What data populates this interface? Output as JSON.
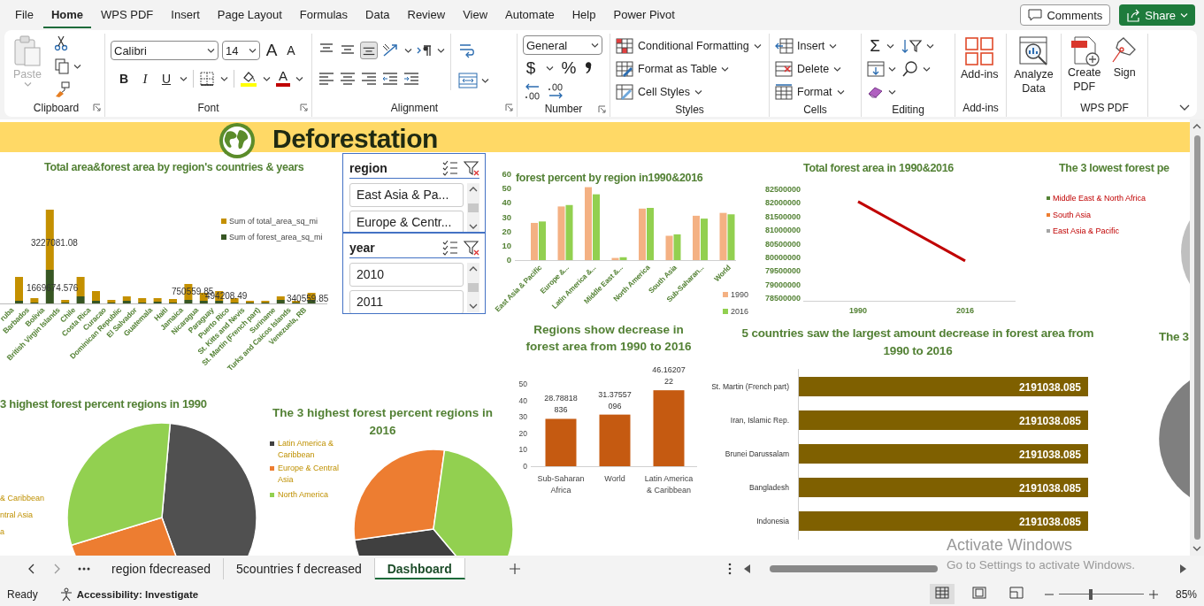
{
  "menu_tabs": [
    {
      "label": "File",
      "selected": false
    },
    {
      "label": "Home",
      "selected": true
    },
    {
      "label": "WPS PDF",
      "selected": false
    },
    {
      "label": "Insert",
      "selected": false
    },
    {
      "label": "Page Layout",
      "selected": false
    },
    {
      "label": "Formulas",
      "selected": false
    },
    {
      "label": "Data",
      "selected": false
    },
    {
      "label": "Review",
      "selected": false
    },
    {
      "label": "View",
      "selected": false
    },
    {
      "label": "Automate",
      "selected": false
    },
    {
      "label": "Help",
      "selected": false
    },
    {
      "label": "Power Pivot",
      "selected": false
    }
  ],
  "comments_button": "Comments",
  "share_button": "Share",
  "ribbon": {
    "clipboard": {
      "paste": "Paste",
      "paste_disabled": true,
      "label": "Clipboard"
    },
    "font": {
      "name": "Calibri",
      "size": "14",
      "grow": "A",
      "shrink": "A",
      "bold": "B",
      "italic": "I",
      "underline": "U",
      "font_color": "A",
      "label": "Font"
    },
    "alignment": {
      "vertical": [
        {
          "selected": false
        },
        {
          "selected": false
        },
        {
          "selected": true
        }
      ],
      "label": "Alignment"
    },
    "number": {
      "format": "General",
      "currency": "$",
      "percent": "%",
      "label": "Number"
    },
    "styles": {
      "items": [
        "Conditional Formatting",
        "Format as Table",
        "Cell Styles"
      ],
      "label": "Styles"
    },
    "cells": {
      "items": [
        "Insert",
        "Delete",
        "Format"
      ],
      "label": "Cells"
    },
    "editing": {
      "autosum": "Σ",
      "label": "Editing"
    },
    "addins": {
      "button": "Add-ins",
      "label": "Add-ins"
    },
    "analyze": {
      "button": "Analyze Data"
    },
    "wps_pdf": {
      "buttons": [
        "Create PDF",
        "Sign"
      ],
      "label": "WPS PDF"
    }
  },
  "dashboard": {
    "title": "Deforestation",
    "area_chart": {
      "title": "Total area&forest area by region's countries & years",
      "legend": [
        {
          "name": "Sum of total_area_sq_mi",
          "color": "#c49000"
        },
        {
          "name": "Sum of forest_area_sq_mi",
          "color": "#375623"
        }
      ],
      "categories": [
        "ruba",
        "Barbados",
        "Bolivia",
        "British Virgin Islands",
        "Chile",
        "Costa Rica",
        "Curacao",
        "Dominican Republic",
        "El Salvador",
        "Guatemala",
        "Haiti",
        "Jamaica",
        "Nicaragua",
        "Paraguay",
        "Puerto Rico",
        "St. Kitts and Nevis",
        "St. Martin (French part)",
        "Suriname",
        "Turks and Caicos Islands",
        "Venezuela, RB"
      ],
      "value_labels": [
        "3227081.08",
        "1669674.576",
        "750559.85",
        "494208.49",
        "340559.85"
      ]
    },
    "region_slicer": {
      "title": "region",
      "items": [
        "East Asia & Pa...",
        "Europe & Centr..."
      ]
    },
    "year_slicer": {
      "title": "year",
      "items": [
        "2010",
        "2011"
      ]
    },
    "percent_chart": {
      "chart_data": {
        "type": "bar",
        "title": "forest percent by region in1990&2016",
        "categories": [
          "East Asia & Pacific",
          "Europe &...",
          "Latin America &...",
          "Middle East &...",
          "North America",
          "South Asia",
          "Sub-Saharan...",
          "World"
        ],
        "series": [
          {
            "name": "1990",
            "color": "#f4b183",
            "values": [
              26,
              37.5,
              51,
              1.5,
              36,
              17,
              31,
              33
            ]
          },
          {
            "name": "2016",
            "color": "#92d050",
            "values": [
              27,
              38.5,
              46,
              2,
              36.5,
              18,
              29,
              32
            ]
          }
        ],
        "ylim": [
          0,
          60
        ],
        "yticks": [
          0,
          10,
          20,
          30,
          40,
          50,
          60
        ],
        "legend": true
      }
    },
    "total_chart": {
      "chart_data": {
        "type": "line",
        "title": "Total forest area in 1990&2016",
        "categories": [
          "1990",
          "2016"
        ],
        "series": [
          {
            "color": "#c00000",
            "values": [
              82050000,
              79870000
            ]
          }
        ],
        "ylim": [
          78500000,
          82500000
        ],
        "yticks": [
          78500000,
          79000000,
          79500000,
          80000000,
          80500000,
          81000000,
          81500000,
          82000000,
          82500000
        ]
      }
    },
    "lowest_pie": {
      "title": "The 3 lowest forest pe",
      "legend": [
        {
          "name": "Middle East & North Africa",
          "color": "#548235"
        },
        {
          "name": "South Asia",
          "color": "#ed7d31"
        },
        {
          "name": "East Asia & Pacific",
          "color": "#a5a5a5"
        }
      ]
    },
    "decrease_chart": {
      "chart_data": {
        "type": "bar",
        "title": "Regions show decrease in forest area from 1990 to 2016",
        "categories": [
          "Sub-Saharan Africa",
          "World",
          "Latin America & Caribbean"
        ],
        "series": [
          {
            "color": "#c55a11",
            "values": [
              28.78818836,
              31.37557096,
              46.1620722
            ]
          }
        ],
        "ylim": [
          0,
          50
        ],
        "yticks": [
          0,
          10,
          20,
          30,
          40,
          50
        ],
        "data_labels": true
      }
    },
    "countries_chart": {
      "chart_data": {
        "type": "bar",
        "orientation": "horizontal",
        "title": "5 countries saw the largest amount decrease in forest area from 1990 to 2016",
        "categories": [
          "St. Martin (French part)",
          "Iran, Islamic Rep.",
          "Brunei Darussalam",
          "Bangladesh",
          "Indonesia"
        ],
        "series": [
          {
            "color": "#7f6000",
            "values": [
              2191038.085,
              2191038.085,
              2191038.085,
              2191038.085,
              2191038.085
            ]
          }
        ],
        "data_labels": true
      }
    },
    "third_pie": {
      "title": "The 3"
    },
    "pie_1990": {
      "title": "3 highest forest percent regions in 1990",
      "legend": [
        "& Caribbean",
        "ntral Asia",
        "a"
      ]
    },
    "pie_2016": {
      "title": "The 3 highest forest percent regions in 2016",
      "legend": [
        {
          "name": "Latin America & Caribbean",
          "color": "#404040"
        },
        {
          "name": "Europe & Central Asia",
          "color": "#ed7d31"
        },
        {
          "name": "North America",
          "color": "#92d050"
        }
      ]
    }
  },
  "sheet_tabs": [
    {
      "label": "region fdecreased",
      "selected": false
    },
    {
      "label": "5countries f decreased",
      "selected": false
    },
    {
      "label": "Dashboard",
      "selected": true
    }
  ],
  "status_bar": {
    "ready": "Ready",
    "accessibility": "Accessibility: Investigate",
    "zoom_slider": {
      "level": 0.38
    },
    "zoom": "85%"
  },
  "activation_notice": {
    "title": "Activate Windows",
    "subtitle": "Go to Settings to activate Windows."
  }
}
